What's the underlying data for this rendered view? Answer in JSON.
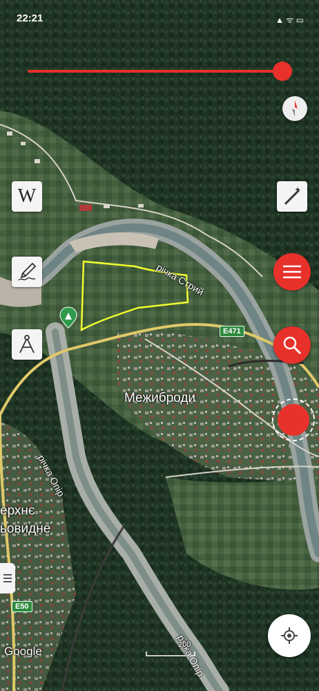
{
  "status_bar": {
    "time": "22:21",
    "icons": "▲ ᯤ ▭"
  },
  "map": {
    "labels": {
      "river_stryi": "річка Стрий",
      "river_opir_1": "річка Опір",
      "river_opir_2": "річка Опір",
      "town_1": "Межиброди",
      "town_2_line1": "ерхнє",
      "town_2_line2": "ьовидне",
      "road_e471": "E471",
      "road_e50": "E50"
    },
    "attribution": "Google",
    "scale_label": "200",
    "camp_marker": "campsite-marker"
  },
  "controls": {
    "slider_value_fraction": 0.97,
    "wikipedia_letter": "W",
    "compass_icon": "compass-icon",
    "magic_icon": "magic-wand-icon",
    "draw_icon": "pencil-draw-icon",
    "measure_icon": "compass-divider-icon",
    "menu_icon": "menu-icon",
    "search_icon": "search-icon",
    "record_icon": "record-icon",
    "list_icon": "list-icon",
    "locate_icon": "locate-icon"
  },
  "colors": {
    "accent_red": "#e8312b",
    "polygon_yellow": "#f2ff2e",
    "road_yellow": "#e0c96a"
  }
}
